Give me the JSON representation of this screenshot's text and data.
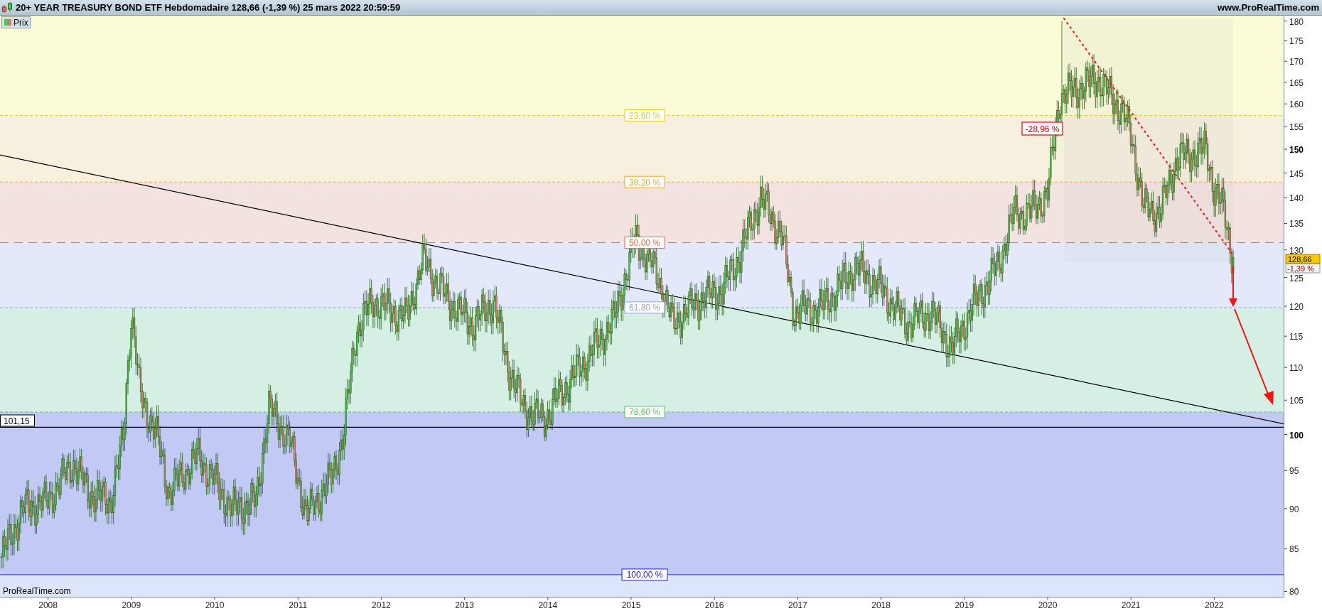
{
  "header": {
    "title": "20+ YEAR TREASURY BOND ETF Hebdomadaire 128,66 (-1,39 %) 25 mars 2022 20:59:59",
    "site": "www.ProRealTime.com"
  },
  "legend": {
    "label": "Prix"
  },
  "fibonacci_levels": [
    {
      "label": "23,60 %",
      "color": "#e0d020"
    },
    {
      "label": "38,20 %",
      "color": "#f0a830"
    },
    {
      "label": "50,00 %",
      "color": "#f06a3a"
    },
    {
      "label": "61,80 %",
      "color": "#98a4e0"
    },
    {
      "label": "78,60 %",
      "color": "#50d050"
    },
    {
      "label": "100,00 %",
      "color": "#2020c0"
    }
  ],
  "support_label": "101,15",
  "drawdown_label": "-28,96 %",
  "last_price": {
    "value": "128,66",
    "change": "-1,39 %"
  },
  "footer_brand": "ProRealTime.com",
  "y_axis": {
    "ticks": [
      {
        "label": "180",
        "major": false
      },
      {
        "label": "175",
        "major": false
      },
      {
        "label": "170",
        "major": false
      },
      {
        "label": "165",
        "major": false
      },
      {
        "label": "160",
        "major": false
      },
      {
        "label": "155",
        "major": false
      },
      {
        "label": "150",
        "major": true
      },
      {
        "label": "145",
        "major": false
      },
      {
        "label": "140",
        "major": false
      },
      {
        "label": "135",
        "major": false
      },
      {
        "label": "130",
        "major": false
      },
      {
        "label": "125",
        "major": false
      },
      {
        "label": "120",
        "major": false
      },
      {
        "label": "115",
        "major": false
      },
      {
        "label": "110",
        "major": false
      },
      {
        "label": "105",
        "major": false
      },
      {
        "label": "100",
        "major": true
      },
      {
        "label": "95",
        "major": false
      },
      {
        "label": "90",
        "major": false
      },
      {
        "label": "85",
        "major": false
      },
      {
        "label": "80",
        "major": false
      }
    ]
  },
  "x_axis": {
    "ticks": [
      "2008",
      "2009",
      "2010",
      "2011",
      "2012",
      "2013",
      "2014",
      "2015",
      "2016",
      "2017",
      "2018",
      "2019",
      "2020",
      "2021",
      "2022"
    ]
  }
}
